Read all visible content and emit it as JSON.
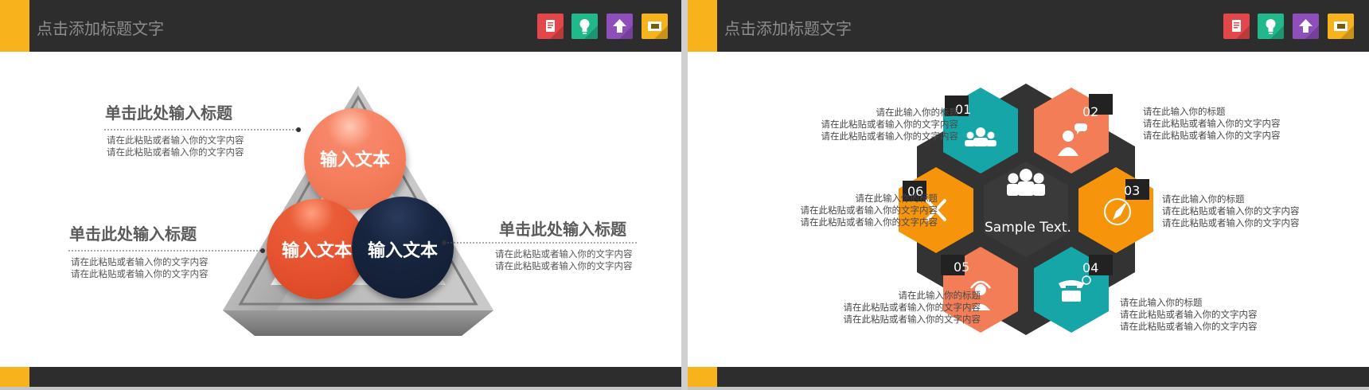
{
  "left_slide": {
    "title": "点击添加标题文字",
    "toolbar_icons": [
      {
        "name": "book-icon",
        "color": "#e3474a"
      },
      {
        "name": "lightbulb-icon",
        "color": "#21b88b"
      },
      {
        "name": "upload-arrow-icon",
        "color": "#8e4fbc"
      },
      {
        "name": "card-icon",
        "color": "#f7b21c"
      }
    ],
    "blocks": [
      {
        "heading": "单击此处输入标题",
        "line1": "请在此粘贴或者输入你的文字内容",
        "line2": "请在此粘贴或者输入你的文字内容"
      },
      {
        "heading": "单击此处输入标题",
        "line1": "请在此粘贴或者输入你的文字内容",
        "line2": "请在此粘贴或者输入你的文字内容"
      },
      {
        "heading": "单击此处输入标题",
        "line1": "请在此粘贴或者输入你的文字内容",
        "line2": "请在此粘贴或者输入你的文字内容"
      }
    ],
    "circles": [
      {
        "label": "输入文本",
        "color": "#f47c5a"
      },
      {
        "label": "输入文本",
        "color": "#e5512e"
      },
      {
        "label": "输入文本",
        "color": "#16233e"
      }
    ]
  },
  "right_slide": {
    "title": "点击添加标题文字",
    "toolbar_icons": [
      {
        "name": "book-icon",
        "color": "#e3474a"
      },
      {
        "name": "lightbulb-icon",
        "color": "#21b88b"
      },
      {
        "name": "upload-arrow-icon",
        "color": "#8e4fbc"
      },
      {
        "name": "card-icon",
        "color": "#f7b21c"
      }
    ],
    "center_text": "Sample Text.",
    "hexes": [
      {
        "number": "01",
        "icon": "team-icon",
        "color": "#16a6a8"
      },
      {
        "number": "02",
        "icon": "chat-person-icon",
        "color": "#f27d57"
      },
      {
        "number": "03",
        "icon": "compass-icon",
        "color": "#f6940c"
      },
      {
        "number": "04",
        "icon": "telephone-icon",
        "color": "#16a6a8"
      },
      {
        "number": "05",
        "icon": "headset-icon",
        "color": "#f27d57"
      },
      {
        "number": "06",
        "icon": "tools-icon",
        "color": "#f6940c"
      }
    ],
    "captions": [
      {
        "title": "请在此输入你的标题",
        "line1": "请在此粘贴或者输入你的文字内容",
        "line2": "请在此粘贴或者输入你的文字内容"
      },
      {
        "title": "请在此输入你的标题",
        "line1": "请在此粘贴或者输入你的文字内容",
        "line2": "请在此粘贴或者输入你的文字内容"
      },
      {
        "title": "请在此输入你的标题",
        "line1": "请在此粘贴或者输入你的文字内容",
        "line2": "请在此粘贴或者输入你的文字内容"
      },
      {
        "title": "请在此输入你的标题",
        "line1": "请在此粘贴或者输入你的文字内容",
        "line2": "请在此粘贴或者输入你的文字内容"
      },
      {
        "title": "请在此输入你的标题",
        "line1": "请在此粘贴或者输入你的文字内容",
        "line2": "请在此粘贴或者输入你的文字内容"
      },
      {
        "title": "请在此输入你的标题",
        "line1": "请在此粘贴或者输入你的文字内容",
        "line2": "请在此粘贴或者输入你的文字内容"
      }
    ]
  }
}
